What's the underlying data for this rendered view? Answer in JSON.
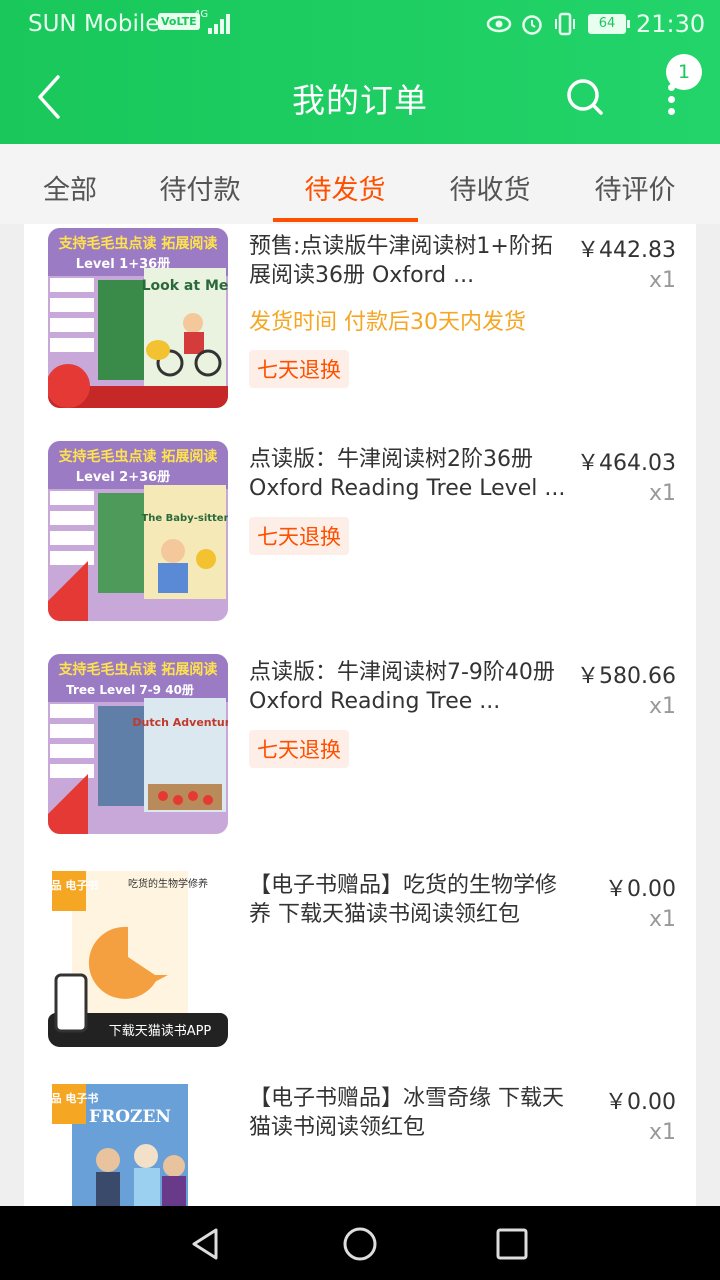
{
  "status": {
    "carrier": "SUN Mobile",
    "volte": "VoLTE",
    "net": "4G",
    "battery": "64",
    "time": "21:30"
  },
  "header": {
    "title": "我的订单",
    "badge_count": "1",
    "bg_color": "#19c75a"
  },
  "tabs": [
    {
      "label": "全部"
    },
    {
      "label": "待付款"
    },
    {
      "label": "待发货"
    },
    {
      "label": "待收货"
    },
    {
      "label": "待评价"
    }
  ],
  "active_tab": "待发货",
  "accent_color": "#ff5000",
  "orders": [
    {
      "title": "预售:点读版牛津阅读树1+阶拓展阅读36册 Oxford ...",
      "price": "￥442.83",
      "qty": "x1",
      "ship_note": "发货时间 付款后30天内发货",
      "tag": "七天退换",
      "thumb": {
        "banner": "支持毛毛虫点读 拓展阅读",
        "level": "Level 1+36册",
        "book": "Look at Me",
        "bg": "#c7a8d8"
      }
    },
    {
      "title": "点读版：牛津阅读树2阶36册 Oxford Reading Tree Level ...",
      "price": "￥464.03",
      "qty": "x1",
      "tag": "七天退换",
      "thumb": {
        "banner": "支持毛毛虫点读 拓展阅读",
        "level": "Level 2+36册",
        "book": "The Baby-sitter",
        "bg": "#c7a8d8"
      }
    },
    {
      "title": "点读版：牛津阅读树7-9阶40册 Oxford Reading Tree ...",
      "price": "￥580.66",
      "qty": "x1",
      "tag": "七天退换",
      "thumb": {
        "banner": "支持毛毛虫点读 拓展阅读",
        "level": "Tree Level 7-9 40册",
        "book": "Dutch Adventure",
        "bg": "#c7a8d8"
      }
    },
    {
      "title": "【电子书赠品】吃货的生物学修养 下载天猫读书阅读领红包",
      "price": "￥0.00",
      "qty": "x1",
      "thumb": {
        "badge": "赠品 电子书",
        "book": "吃货的生物学修养",
        "footer": "下载天猫读书APP",
        "bg": "#fff4e0"
      }
    },
    {
      "title": "【电子书赠品】冰雪奇缘 下载天猫读书阅读领红包",
      "price": "￥0.00",
      "qty": "x1",
      "thumb": {
        "badge": "赠品 电子书",
        "book": "FROZEN",
        "bg": "#6aa0d8"
      }
    }
  ]
}
